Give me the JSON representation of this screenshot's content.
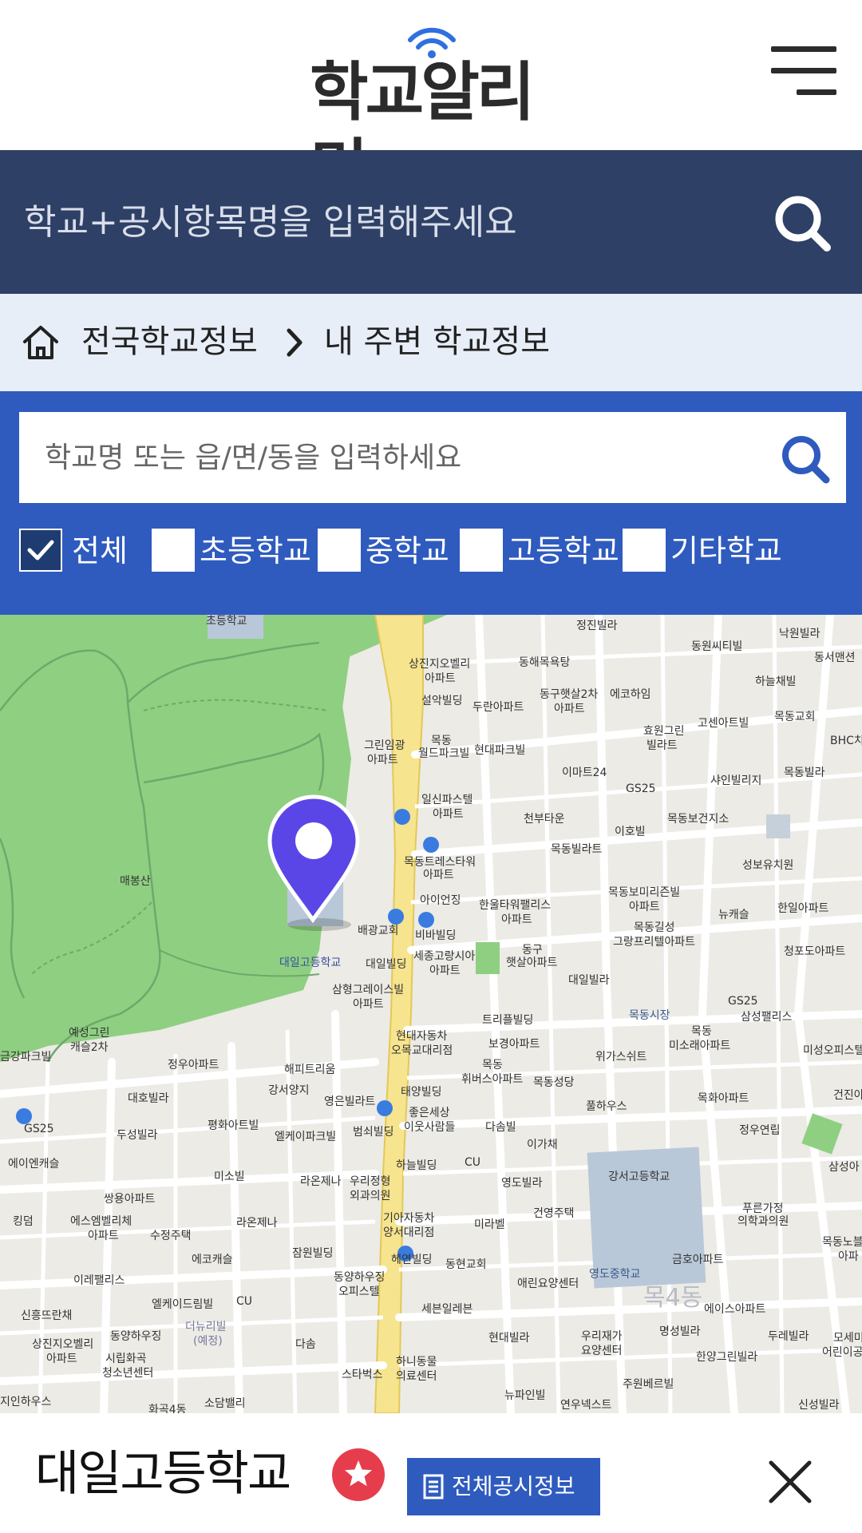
{
  "header": {
    "logo_text": "학교알리미",
    "logo_wave_icon": "wifi-signal-icon",
    "menu_icon": "hamburger-menu-icon"
  },
  "global_search": {
    "placeholder": "학교+공시항목명을 입력해주세요",
    "icon": "search-icon"
  },
  "breadcrumb": {
    "home_icon": "home-icon",
    "items": [
      "전국학교정보",
      "내 주변 학교정보"
    ]
  },
  "local_search": {
    "placeholder": "학교명 또는 읍/면/동을 입력하세요",
    "icon": "search-icon"
  },
  "filters": [
    {
      "label": "전체",
      "checked": true
    },
    {
      "label": "초등학교",
      "checked": false
    },
    {
      "label": "중학교",
      "checked": false
    },
    {
      "label": "고등학교",
      "checked": false
    },
    {
      "label": "기타학교",
      "checked": false
    }
  ],
  "map": {
    "selected_school_label": "대일고등학교",
    "labels": {
      "l1": "초등학교",
      "l2": "정진빌라",
      "l3": "낙원빌라",
      "l4": "동원씨티빌",
      "l5": "상진지오벨리",
      "l6": "아파트",
      "l7": "동해목욕탕",
      "l8": "동서맨션",
      "l9": "하늘채빌",
      "l10": "설악빌딩",
      "l11": "두란아파트",
      "l12": "동구햇살2차",
      "l13": "아파트",
      "l14": "에코하임",
      "l15": "고센아트빌",
      "l16": "목동교회",
      "l17": "그린임광",
      "l18": "아파트",
      "l19": "목동",
      "l20": "월드파크빌",
      "l21": "현대파크빌",
      "l22": "효원그린",
      "l23": "빌라트",
      "l24": "BHC치",
      "l25": "이마트24",
      "l26": "GS25",
      "l27": "샤인빌리지",
      "l28": "목동빌라",
      "l29": "일신파스텔",
      "l30": "아파트",
      "l31": "천부타운",
      "l32": "목동보건지소",
      "l33": "이호빌",
      "l34": "목동빌라트",
      "l35": "목동트레스타워",
      "l36": "아파트",
      "l37": "성보유치원",
      "l38": "매봉산",
      "l39": "아이언징",
      "l40": "한울타워팰리스",
      "l41": "아파트",
      "l42": "목동보미리즌빌",
      "l43": "아파트",
      "l44": "뉴캐슬",
      "l45": "한일아파트",
      "l46": "배광교회",
      "l47": "비바빌딩",
      "l48": "목동길성",
      "l49": "그랑프리텔아파트",
      "l50": "세종고랑시아",
      "l51": "아파트",
      "l52": "동구",
      "l53": "햇살아파트",
      "l54": "청포도아파트",
      "l55": "대일빌딩",
      "l56": "대일빌라",
      "l57": "GS25",
      "l58": "삼성팰리스",
      "l59": "삼형그레이스빌",
      "l60": "아파트",
      "l61": "목동시장",
      "l62": "트리플빌딩",
      "l63": "예성그린",
      "l64": "캐슬2차",
      "l65": "금강파크빌",
      "l66": "현대자동차",
      "l67": "오목교대리점",
      "l68": "보경아파트",
      "l69": "위가스쉬트",
      "l70": "목동",
      "l71": "미소래아파트",
      "l72": "미성오피스텔",
      "l73": "정우아파트",
      "l74": "해피트리움",
      "l75": "목동",
      "l76": "휘버스아파트",
      "l77": "목동성당",
      "l78": "대호빌라",
      "l79": "강서양지",
      "l80": "영은빌라트",
      "l81": "태양빌딩",
      "l82": "좋은세상",
      "l83": "이웃사람들",
      "l84": "풀하우스",
      "l85": "목화아파트",
      "l86": "건진아",
      "l87": "GS25",
      "l88": "두성빌라",
      "l89": "평화아트빌",
      "l90": "엘케이파크빌",
      "l91": "범쇠빌딩",
      "l92": "다솜빌",
      "l93": "이가채",
      "l94": "정우연립",
      "l95": "에이엔캐슬",
      "l96": "CU",
      "l97": "강서고등학교",
      "l98": "삼성아",
      "l99": "미소빌",
      "l100": "하늘빌딩",
      "l101": "라온제나",
      "l102": "우리정형",
      "l103": "외과의원",
      "l104": "영도빌라",
      "l105": "쌍용아파트",
      "l106": "건영주택",
      "l107": "푸른가정",
      "l108": "의학과의원",
      "l109": "킹덤",
      "l110": "에스엠벨리체",
      "l111": "아파트",
      "l112": "수정주택",
      "l113": "라온제나",
      "l114": "기아자동차",
      "l115": "양서대리점",
      "l116": "미라벨",
      "l117": "목동노블",
      "l118": "아파",
      "l119": "에코캐슬",
      "l120": "잠원빌딩",
      "l121": "헤연빌딩",
      "l122": "동현교회",
      "l123": "금호아파트",
      "l124": "이레팰리스",
      "l125": "영도중학교",
      "l126": "동양하우징",
      "l127": "오피스텔",
      "l128": "애린요양센터",
      "l129": "엘케이드림빌",
      "l130": "CU",
      "l131": "세븐일레븐",
      "l132": "에이스아파트",
      "l133": "신흥뜨란채",
      "l134": "동양하우징",
      "l135": "더뉴리빌",
      "l136": "(예정)",
      "l137": "현대빌라",
      "l138": "우리재가",
      "l139": "요양센터",
      "l140": "명성빌라",
      "l141": "두레빌라",
      "l142": "모세미",
      "l143": "어린이공",
      "l144": "상진지오벨리",
      "l145": "아파트",
      "l146": "시립화곡",
      "l147": "청소년센터",
      "l148": "다솜",
      "l149": "스타벅스",
      "l150": "하니동물",
      "l151": "의료센터",
      "l152": "한양그린빌라",
      "l153": "주원베르빌",
      "l154": "지인하우스",
      "l155": "화곡4동",
      "l156": "소담밸리",
      "l157": "뉴파인빌",
      "l158": "연우넥스트",
      "l159": "신성빌라",
      "l160": "목4동"
    }
  },
  "sheet": {
    "school_name": "대일고등학교",
    "favorite_icon": "star-icon",
    "info_button_label": "전체공시정보",
    "info_button_icon": "document-icon",
    "close_icon": "close-icon"
  },
  "colors": {
    "header_bar": "#2f4066",
    "breadcrumb_bg": "#e8eef8",
    "panel_blue": "#2f5bbf",
    "favorite_red": "#e63d4c",
    "marker_purple": "#5a46e6"
  }
}
